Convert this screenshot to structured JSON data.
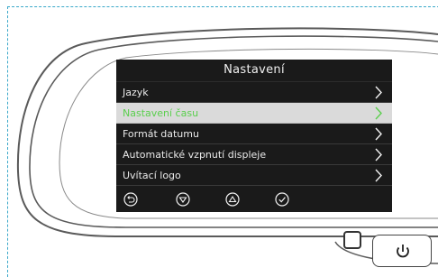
{
  "screen": {
    "title": "Nastavení",
    "menu_items": [
      {
        "label": "Jazyk",
        "selected": false
      },
      {
        "label": "Nastavení času",
        "selected": true
      },
      {
        "label": "Formát datumu",
        "selected": false
      },
      {
        "label": "Automatické vzpnutí displeje",
        "selected": false
      },
      {
        "label": "Uvítací logo",
        "selected": false
      }
    ],
    "buttons": [
      "back-icon",
      "down-icon",
      "up-icon",
      "confirm-icon"
    ]
  },
  "physical_buttons": [
    "square-button",
    "power-icon"
  ],
  "colors": {
    "selected_text": "#5bcf4e",
    "selected_bg": "#dadada",
    "screen_bg": "#1a1a1a",
    "guide_border": "#3aa8c9"
  }
}
